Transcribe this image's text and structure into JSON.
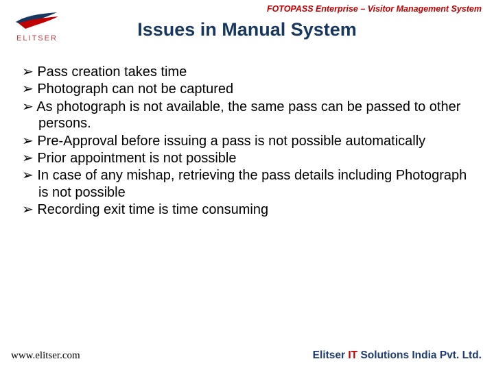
{
  "header": {
    "product_line": "FOTOPASS Enterprise – Visitor Management System"
  },
  "logo": {
    "brand_text": "ELITSER"
  },
  "slide": {
    "title": "Issues in Manual System",
    "bullets": [
      "Pass creation takes time",
      "Photograph can not be captured",
      "As photograph is not available, the same pass can be passed to other persons.",
      "Pre-Approval before issuing a pass is not possible automatically",
      "Prior appointment is not possible",
      "In case of any mishap, retrieving the pass details including Photograph is not possible",
      "Recording exit time is time consuming"
    ]
  },
  "footer": {
    "url": "www.elitser.com",
    "company_prefix": "Elitser ",
    "company_highlight": "IT",
    "company_suffix": " Solutions India Pvt. Ltd."
  }
}
